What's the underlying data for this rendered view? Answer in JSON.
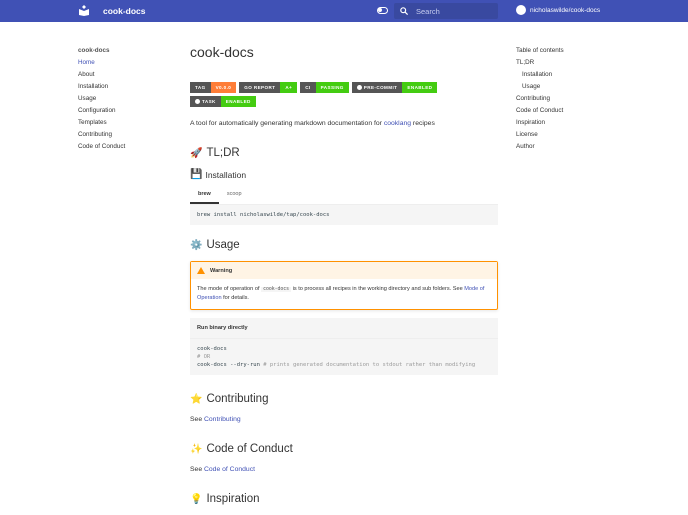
{
  "header": {
    "title": "cook-docs",
    "search_placeholder": "Search",
    "repo": "nicholaswilde/cook-docs"
  },
  "nav": {
    "heading": "cook-docs",
    "items": [
      "Home",
      "About",
      "Installation",
      "Usage",
      "Configuration",
      "Templates",
      "Contributing",
      "Code of Conduct"
    ]
  },
  "toc": {
    "heading": "Table of contents",
    "items": [
      {
        "label": "TL;DR",
        "sub": false
      },
      {
        "label": "Installation",
        "sub": true
      },
      {
        "label": "Usage",
        "sub": true
      },
      {
        "label": "Contributing",
        "sub": false
      },
      {
        "label": "Code of Conduct",
        "sub": false
      },
      {
        "label": "Inspiration",
        "sub": false
      },
      {
        "label": "License",
        "sub": false
      },
      {
        "label": "Author",
        "sub": false
      }
    ]
  },
  "page": {
    "title": "cook-docs",
    "badges": [
      {
        "l": "TAG",
        "r": "V0.0.0",
        "c": "o"
      },
      {
        "l": "GO REPORT",
        "r": "A+",
        "c": "g"
      },
      {
        "l": "CI",
        "r": "PASSING",
        "c": "g"
      },
      {
        "l": "PRE-COMMIT",
        "r": "ENABLED",
        "c": "g",
        "icon": true
      },
      {
        "l": "TASK",
        "r": "ENABLED",
        "c": "g",
        "icon": true
      }
    ],
    "intro": "A tool for automatically generating markdown documentation for ",
    "intro_link": "cooklang",
    "intro_end": " recipes",
    "tldr": "TL;DR",
    "installation": "Installation",
    "tabs": [
      "brew",
      "scoop"
    ],
    "install_cmd": "brew install nicholaswilde/tap/cook-docs",
    "usage": "Usage",
    "warning": {
      "title": "Warning",
      "t1": "The mode of operation of ",
      "code": "cook-docs",
      "t2": " is to process all recipes in the working directory and sub folders. See ",
      "link": "Mode of Operation",
      "t3": " for details."
    },
    "run": {
      "title": "Run binary directly",
      "l1": "cook-docs",
      "l2": "# OR",
      "l3a": "cook-docs --dry-run",
      "l3b": " # prints generated documentation to stdout rather than modifying"
    },
    "contributing": "Contributing",
    "see": "See ",
    "contributing_link": "Contributing",
    "coc": "Code of Conduct",
    "coc_link": "Code of Conduct",
    "inspiration": "Inspiration",
    "emoji": {
      "tldr": "🚀",
      "install": "💾",
      "usage": "⚙️",
      "contrib": "⭐",
      "coc": "✨",
      "insp": "💡"
    }
  }
}
